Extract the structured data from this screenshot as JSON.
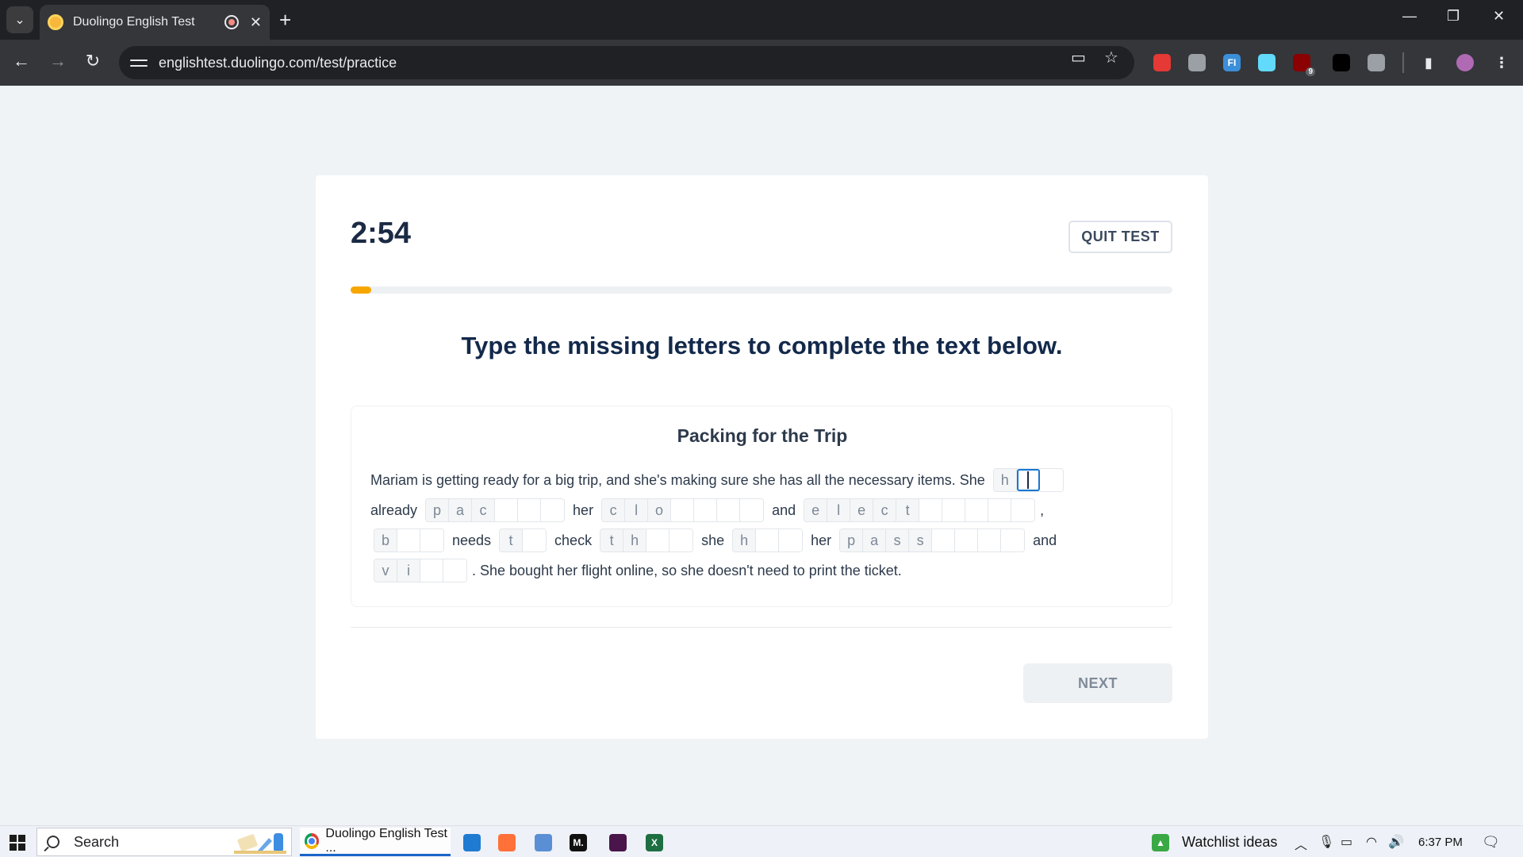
{
  "browser": {
    "tab_title": "Duolingo English Test",
    "tab_close": "✕",
    "new_tab": "+",
    "url": "englishtest.duolingo.com/test/practice",
    "window_controls": {
      "minimize": "—",
      "restore": "❐",
      "close": "✕"
    },
    "extensions": [
      {
        "name": "hand-extension-icon",
        "color": "#e53935"
      },
      {
        "name": "target-extension-icon",
        "color": "#9aa0a6"
      },
      {
        "name": "fi-extension-icon",
        "color": "#3b8fd9",
        "label": "FI"
      },
      {
        "name": "react-extension-icon",
        "color": "#61dafb"
      },
      {
        "name": "ublock-extension-icon",
        "color": "#8b0000",
        "badge": "9"
      },
      {
        "name": "dark-triangle-extension-icon",
        "color": "#000000"
      },
      {
        "name": "puzzle-extensions-icon",
        "color": "#9aa0a6"
      }
    ]
  },
  "test": {
    "timer": "2:54",
    "quit_label": "QUIT TEST",
    "progress_fraction": 0.025,
    "progress_color": "#f7a600",
    "instruction": "Type the missing letters to complete the text below.",
    "passage_title": "Packing for the Trip",
    "lines": [
      [
        {
          "text": "Mariam is getting ready for a big trip, and she's making sure she has all the necessary items. She"
        },
        {
          "word": {
            "given": [
              "h"
            ],
            "blanks": 2,
            "active_blank": 0
          }
        }
      ],
      [
        {
          "text": "already"
        },
        {
          "word": {
            "given": [
              "p",
              "a",
              "c"
            ],
            "blanks": 3
          }
        },
        {
          "text": "her"
        },
        {
          "word": {
            "given": [
              "c",
              "l",
              "o"
            ],
            "blanks": 4
          }
        },
        {
          "text": "and"
        },
        {
          "word": {
            "given": [
              "e",
              "l",
              "e",
              "c",
              "t"
            ],
            "blanks": 5
          }
        },
        {
          "text": ",",
          "punct": true
        }
      ],
      [
        {
          "word": {
            "given": [
              "b"
            ],
            "blanks": 2
          }
        },
        {
          "text": "needs"
        },
        {
          "word": {
            "given": [
              "t"
            ],
            "blanks": 1
          }
        },
        {
          "text": "check"
        },
        {
          "word": {
            "given": [
              "t",
              "h"
            ],
            "blanks": 2
          }
        },
        {
          "text": "she"
        },
        {
          "word": {
            "given": [
              "h"
            ],
            "blanks": 2
          }
        },
        {
          "text": "her"
        },
        {
          "word": {
            "given": [
              "p",
              "a",
              "s",
              "s"
            ],
            "blanks": 4
          }
        },
        {
          "text": "and"
        }
      ],
      [
        {
          "word": {
            "given": [
              "v",
              "i"
            ],
            "blanks": 2
          }
        },
        {
          "text": ". She bought her flight online, so she doesn't need to print the ticket.",
          "punct": true
        }
      ]
    ],
    "next_label": "NEXT"
  },
  "taskbar": {
    "search_placeholder": "Search",
    "active_app_label": "Duolingo English Test ...",
    "pinned": [
      {
        "name": "vscode-icon",
        "color": "#1f7ad1"
      },
      {
        "name": "firefox-icon",
        "color": "#ff7139"
      },
      {
        "name": "paint-icon",
        "color": "#5a8fd6"
      },
      {
        "name": "medium-icon",
        "color": "#111111",
        "label": "M."
      },
      {
        "name": "slack-icon",
        "color": "#4a154b"
      },
      {
        "name": "excel-icon",
        "color": "#1d6f42",
        "label": "X"
      }
    ],
    "widget_label": "Watchlist ideas",
    "time": "6:37 PM"
  }
}
